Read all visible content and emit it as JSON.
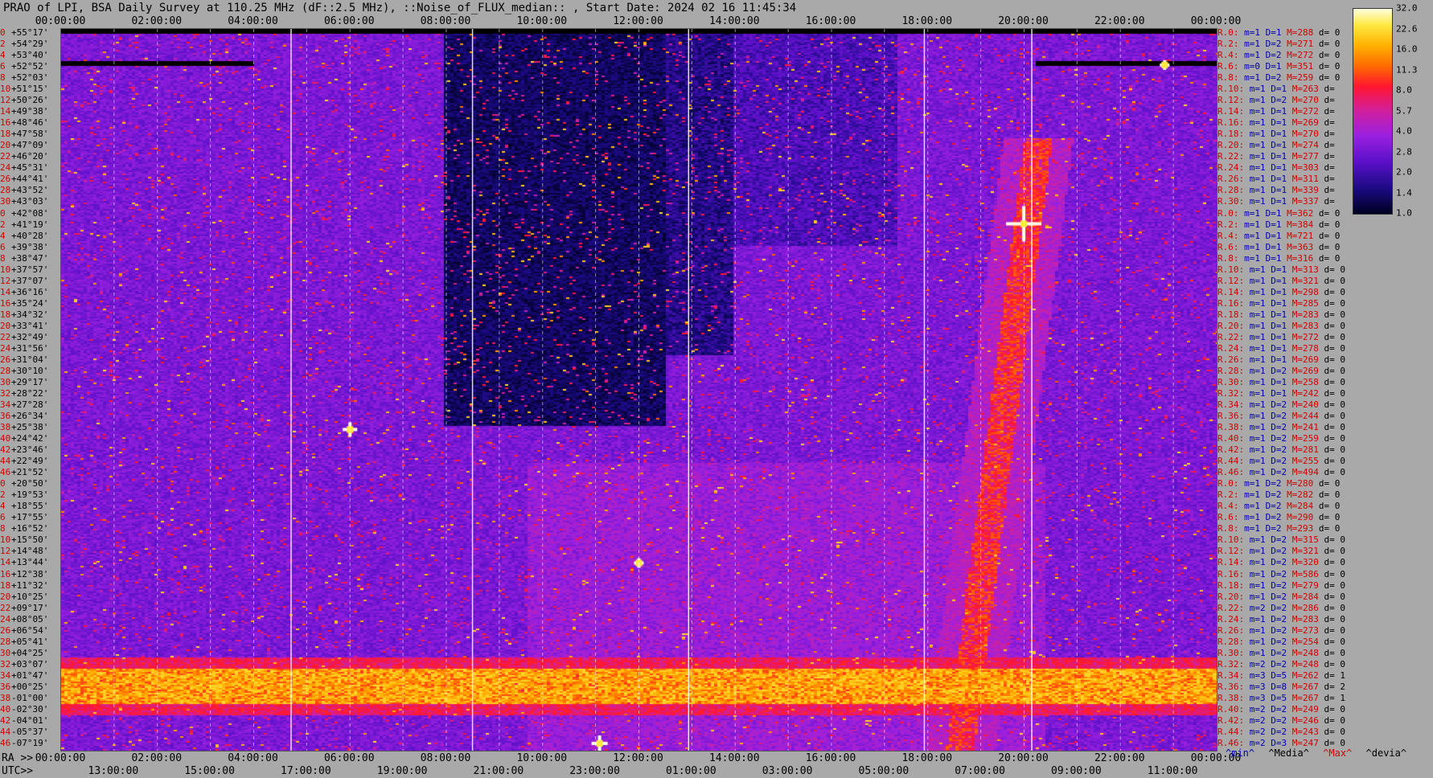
{
  "header": {
    "title": "PRAO of LPI, BSA Daily Survey at 110.25 MHz (dF::2.5 MHz), ::Noise_of_FLUX_median:: , Start Date: 2024 02 16 11:45:34"
  },
  "top_axis": {
    "ticks": [
      "00:00:00",
      "02:00:00",
      "04:00:00",
      "06:00:00",
      "08:00:00",
      "10:00:00",
      "12:00:00",
      "14:00:00",
      "16:00:00",
      "18:00:00",
      "20:00:00",
      "22:00:00",
      "00:00:00"
    ]
  },
  "bottom_axis": {
    "ra_prefix": "RA >>",
    "ra_ticks": [
      "00:00:00",
      "02:00:00",
      "04:00:00",
      "06:00:00",
      "08:00:00",
      "10:00:00",
      "12:00:00",
      "14:00:00",
      "16:00:00",
      "18:00:00",
      "20:00:00",
      "22:00:00",
      "00:00:00"
    ],
    "utc_prefix": "UTC>>",
    "utc_ticks": [
      "13:00:00",
      "15:00:00",
      "17:00:00",
      "19:00:00",
      "21:00:00",
      "23:00:00",
      "01:00:00",
      "03:00:00",
      "05:00:00",
      "07:00:00",
      "09:00:00",
      "11:00:00"
    ]
  },
  "left_labels": {
    "rows": [
      {
        "idx": "0",
        "dec": "+55°17'"
      },
      {
        "idx": "2",
        "dec": "+54°29'"
      },
      {
        "idx": "4",
        "dec": "+53°40'"
      },
      {
        "idx": "6",
        "dec": "+52°52'"
      },
      {
        "idx": "8",
        "dec": "+52°03'"
      },
      {
        "idx": "10",
        "dec": "+51°15'"
      },
      {
        "idx": "12",
        "dec": "+50°26'"
      },
      {
        "idx": "14",
        "dec": "+49°38'"
      },
      {
        "idx": "16",
        "dec": "+48°46'"
      },
      {
        "idx": "18",
        "dec": "+47°58'"
      },
      {
        "idx": "20",
        "dec": "+47°09'"
      },
      {
        "idx": "22",
        "dec": "+46°20'"
      },
      {
        "idx": "24",
        "dec": "+45°31'"
      },
      {
        "idx": "26",
        "dec": "+44°41'"
      },
      {
        "idx": "28",
        "dec": "+43°52'"
      },
      {
        "idx": "30",
        "dec": "+43°03'"
      },
      {
        "idx": "0",
        "dec": "+42°08'"
      },
      {
        "idx": "2",
        "dec": "+41°19'"
      },
      {
        "idx": "4",
        "dec": "+40°28'"
      },
      {
        "idx": "6",
        "dec": "+39°38'"
      },
      {
        "idx": "8",
        "dec": "+38°47'"
      },
      {
        "idx": "10",
        "dec": "+37°57'"
      },
      {
        "idx": "12",
        "dec": "+37°07'"
      },
      {
        "idx": "14",
        "dec": "+36°16'"
      },
      {
        "idx": "16",
        "dec": "+35°24'"
      },
      {
        "idx": "18",
        "dec": "+34°32'"
      },
      {
        "idx": "20",
        "dec": "+33°41'"
      },
      {
        "idx": "22",
        "dec": "+32°49'"
      },
      {
        "idx": "24",
        "dec": "+31°56'"
      },
      {
        "idx": "26",
        "dec": "+31°04'"
      },
      {
        "idx": "28",
        "dec": "+30°10'"
      },
      {
        "idx": "30",
        "dec": "+29°17'"
      },
      {
        "idx": "32",
        "dec": "+28°22'"
      },
      {
        "idx": "34",
        "dec": "+27°28'"
      },
      {
        "idx": "36",
        "dec": "+26°34'"
      },
      {
        "idx": "38",
        "dec": "+25°38'"
      },
      {
        "idx": "40",
        "dec": "+24°42'"
      },
      {
        "idx": "42",
        "dec": "+23°46'"
      },
      {
        "idx": "44",
        "dec": "+22°49'"
      },
      {
        "idx": "46",
        "dec": "+21°52'"
      },
      {
        "idx": "0",
        "dec": "+20°50'"
      },
      {
        "idx": "2",
        "dec": "+19°53'"
      },
      {
        "idx": "4",
        "dec": "+18°55'"
      },
      {
        "idx": "6",
        "dec": "+17°55'"
      },
      {
        "idx": "8",
        "dec": "+16°52'"
      },
      {
        "idx": "10",
        "dec": "+15°50'"
      },
      {
        "idx": "12",
        "dec": "+14°48'"
      },
      {
        "idx": "14",
        "dec": "+13°44'"
      },
      {
        "idx": "16",
        "dec": "+12°38'"
      },
      {
        "idx": "18",
        "dec": "+11°32'"
      },
      {
        "idx": "20",
        "dec": "+10°25'"
      },
      {
        "idx": "22",
        "dec": "+09°17'"
      },
      {
        "idx": "24",
        "dec": "+08°05'"
      },
      {
        "idx": "26",
        "dec": "+06°54'"
      },
      {
        "idx": "28",
        "dec": "+05°41'"
      },
      {
        "idx": "30",
        "dec": "+04°25'"
      },
      {
        "idx": "32",
        "dec": "+03°07'"
      },
      {
        "idx": "34",
        "dec": "+01°47'"
      },
      {
        "idx": "36",
        "dec": "+00°25'"
      },
      {
        "idx": "38",
        "dec": "-01°00'"
      },
      {
        "idx": "40",
        "dec": "-02°30'"
      },
      {
        "idx": "42",
        "dec": "-04°01'"
      },
      {
        "idx": "44",
        "dec": "-05°37'"
      },
      {
        "idx": "46",
        "dec": "-07°19'"
      }
    ]
  },
  "right_stats": {
    "rows": [
      {
        "r": "R.0:",
        "m": "m=1",
        "D": "D=1",
        "M": "M=288",
        "d": "d= 0"
      },
      {
        "r": "R.2:",
        "m": "m=1",
        "D": "D=2",
        "M": "M=271",
        "d": "d= 0"
      },
      {
        "r": "R.4:",
        "m": "m=1",
        "D": "D=2",
        "M": "M=272",
        "d": "d= 0"
      },
      {
        "r": "R.6:",
        "m": "m=0",
        "D": "D=1",
        "M": "M=351",
        "d": "d= 0"
      },
      {
        "r": "R.8:",
        "m": "m=1",
        "D": "D=2",
        "M": "M=259",
        "d": "d= 0"
      },
      {
        "r": "R.10:",
        "m": "m=1",
        "D": "D=1",
        "M": "M=263",
        "d": "d="
      },
      {
        "r": "R.12:",
        "m": "m=1",
        "D": "D=2",
        "M": "M=270",
        "d": "d="
      },
      {
        "r": "R.14:",
        "m": "m=1",
        "D": "D=1",
        "M": "M=272",
        "d": "d="
      },
      {
        "r": "R.16:",
        "m": "m=1",
        "D": "D=1",
        "M": "M=269",
        "d": "d="
      },
      {
        "r": "R.18:",
        "m": "m=1",
        "D": "D=1",
        "M": "M=270",
        "d": "d="
      },
      {
        "r": "R.20:",
        "m": "m=1",
        "D": "D=1",
        "M": "M=274",
        "d": "d="
      },
      {
        "r": "R.22:",
        "m": "m=1",
        "D": "D=1",
        "M": "M=277",
        "d": "d="
      },
      {
        "r": "R.24:",
        "m": "m=1",
        "D": "D=1",
        "M": "M=303",
        "d": "d="
      },
      {
        "r": "R.26:",
        "m": "m=1",
        "D": "D=1",
        "M": "M=311",
        "d": "d="
      },
      {
        "r": "R.28:",
        "m": "m=1",
        "D": "D=1",
        "M": "M=339",
        "d": "d="
      },
      {
        "r": "R.30:",
        "m": "m=1",
        "D": "D=1",
        "M": "M=337",
        "d": "d="
      },
      {
        "r": "R.0:",
        "m": "m=1",
        "D": "D=1",
        "M": "M=362",
        "d": "d= 0"
      },
      {
        "r": "R.2:",
        "m": "m=1",
        "D": "D=1",
        "M": "M=384",
        "d": "d= 0"
      },
      {
        "r": "R.4:",
        "m": "m=1",
        "D": "D=1",
        "M": "M=721",
        "d": "d= 0"
      },
      {
        "r": "R.6:",
        "m": "m=1",
        "D": "D=1",
        "M": "M=363",
        "d": "d= 0"
      },
      {
        "r": "R.8:",
        "m": "m=1",
        "D": "D=1",
        "M": "M=316",
        "d": "d= 0"
      },
      {
        "r": "R.10:",
        "m": "m=1",
        "D": "D=1",
        "M": "M=313",
        "d": "d= 0"
      },
      {
        "r": "R.12:",
        "m": "m=1",
        "D": "D=1",
        "M": "M=321",
        "d": "d= 0"
      },
      {
        "r": "R.14:",
        "m": "m=1",
        "D": "D=1",
        "M": "M=298",
        "d": "d= 0"
      },
      {
        "r": "R.16:",
        "m": "m=1",
        "D": "D=1",
        "M": "M=285",
        "d": "d= 0"
      },
      {
        "r": "R.18:",
        "m": "m=1",
        "D": "D=1",
        "M": "M=283",
        "d": "d= 0"
      },
      {
        "r": "R.20:",
        "m": "m=1",
        "D": "D=1",
        "M": "M=283",
        "d": "d= 0"
      },
      {
        "r": "R.22:",
        "m": "m=1",
        "D": "D=1",
        "M": "M=272",
        "d": "d= 0"
      },
      {
        "r": "R.24:",
        "m": "m=1",
        "D": "D=1",
        "M": "M=278",
        "d": "d= 0"
      },
      {
        "r": "R.26:",
        "m": "m=1",
        "D": "D=1",
        "M": "M=269",
        "d": "d= 0"
      },
      {
        "r": "R.28:",
        "m": "m=1",
        "D": "D=2",
        "M": "M=269",
        "d": "d= 0"
      },
      {
        "r": "R.30:",
        "m": "m=1",
        "D": "D=1",
        "M": "M=258",
        "d": "d= 0"
      },
      {
        "r": "R.32:",
        "m": "m=1",
        "D": "D=1",
        "M": "M=242",
        "d": "d= 0"
      },
      {
        "r": "R.34:",
        "m": "m=1",
        "D": "D=2",
        "M": "M=240",
        "d": "d= 0"
      },
      {
        "r": "R.36:",
        "m": "m=1",
        "D": "D=2",
        "M": "M=244",
        "d": "d= 0"
      },
      {
        "r": "R.38:",
        "m": "m=1",
        "D": "D=2",
        "M": "M=241",
        "d": "d= 0"
      },
      {
        "r": "R.40:",
        "m": "m=1",
        "D": "D=2",
        "M": "M=259",
        "d": "d= 0"
      },
      {
        "r": "R.42:",
        "m": "m=1",
        "D": "D=2",
        "M": "M=281",
        "d": "d= 0"
      },
      {
        "r": "R.44:",
        "m": "m=1",
        "D": "D=2",
        "M": "M=255",
        "d": "d= 0"
      },
      {
        "r": "R.46:",
        "m": "m=1",
        "D": "D=2",
        "M": "M=494",
        "d": "d= 0"
      },
      {
        "r": "R.0:",
        "m": "m=1",
        "D": "D=2",
        "M": "M=280",
        "d": "d= 0"
      },
      {
        "r": "R.2:",
        "m": "m=1",
        "D": "D=2",
        "M": "M=282",
        "d": "d= 0"
      },
      {
        "r": "R.4:",
        "m": "m=1",
        "D": "D=2",
        "M": "M=284",
        "d": "d= 0"
      },
      {
        "r": "R.6:",
        "m": "m=1",
        "D": "D=2",
        "M": "M=290",
        "d": "d= 0"
      },
      {
        "r": "R.8:",
        "m": "m=1",
        "D": "D=2",
        "M": "M=293",
        "d": "d= 0"
      },
      {
        "r": "R.10:",
        "m": "m=1",
        "D": "D=2",
        "M": "M=315",
        "d": "d= 0"
      },
      {
        "r": "R.12:",
        "m": "m=1",
        "D": "D=2",
        "M": "M=321",
        "d": "d= 0"
      },
      {
        "r": "R.14:",
        "m": "m=1",
        "D": "D=2",
        "M": "M=320",
        "d": "d= 0"
      },
      {
        "r": "R.16:",
        "m": "m=1",
        "D": "D=2",
        "M": "M=586",
        "d": "d= 0"
      },
      {
        "r": "R.18:",
        "m": "m=1",
        "D": "D=2",
        "M": "M=279",
        "d": "d= 0"
      },
      {
        "r": "R.20:",
        "m": "m=1",
        "D": "D=2",
        "M": "M=284",
        "d": "d= 0"
      },
      {
        "r": "R.22:",
        "m": "m=2",
        "D": "D=2",
        "M": "M=286",
        "d": "d= 0"
      },
      {
        "r": "R.24:",
        "m": "m=1",
        "D": "D=2",
        "M": "M=283",
        "d": "d= 0"
      },
      {
        "r": "R.26:",
        "m": "m=1",
        "D": "D=2",
        "M": "M=273",
        "d": "d= 0"
      },
      {
        "r": "R.28:",
        "m": "m=1",
        "D": "D=2",
        "M": "M=254",
        "d": "d= 0"
      },
      {
        "r": "R.30:",
        "m": "m=1",
        "D": "D=2",
        "M": "M=248",
        "d": "d= 0"
      },
      {
        "r": "R.32:",
        "m": "m=2",
        "D": "D=2",
        "M": "M=248",
        "d": "d= 0"
      },
      {
        "r": "R.34:",
        "m": "m=3",
        "D": "D=5",
        "M": "M=262",
        "d": "d= 1"
      },
      {
        "r": "R.36:",
        "m": "m=3",
        "D": "D=8",
        "M": "M=267",
        "d": "d= 2"
      },
      {
        "r": "R.38:",
        "m": "m=3",
        "D": "D=5",
        "M": "M=267",
        "d": "d= 1"
      },
      {
        "r": "R.40:",
        "m": "m=2",
        "D": "D=2",
        "M": "M=249",
        "d": "d= 0"
      },
      {
        "r": "R.42:",
        "m": "m=2",
        "D": "D=2",
        "M": "M=246",
        "d": "d= 0"
      },
      {
        "r": "R.44:",
        "m": "m=2",
        "D": "D=2",
        "M": "M=243",
        "d": "d= 0"
      },
      {
        "r": "R.46:",
        "m": "m=2",
        "D": "D=3",
        "M": "M=247",
        "d": "d= 0"
      }
    ]
  },
  "colorbar": {
    "ticks": [
      "32.0",
      "22.6",
      "16.0",
      "11.3",
      "8.0",
      "5.7",
      "4.0",
      "2.8",
      "2.0",
      "1.4",
      "1.0"
    ],
    "colors": [
      "#000022",
      "#1a0a80",
      "#5a10c8",
      "#9a20e0",
      "#d020a0",
      "#ff1530",
      "#ff6a00",
      "#ffb000",
      "#ffe840",
      "#ffffe0"
    ]
  },
  "legend": {
    "min": "^min^",
    "median": "^Media^",
    "max": "^Max^",
    "dev": "^devia^"
  },
  "chart_data": {
    "type": "heatmap",
    "title": "PRAO of LPI, BSA Daily Survey at 110.25 MHz (dF::2.5 MHz), ::Noise_of_FLUX_median:: , Start Date: 2024 02 16 11:45:34",
    "x_axis": {
      "range": [
        "00:00:00",
        "24:00:00"
      ],
      "label": "RA"
    },
    "y_axis": {
      "range": [
        "+55°17'",
        "-07°19'"
      ]
    },
    "value_range": [
      1.0,
      32.0
    ],
    "scale": "log2",
    "rows": 64,
    "features": [
      {
        "desc": "bright saturated horizontal band",
        "dec_from": "+01°47'",
        "dec_to": "-01°00'",
        "ra_from": "00:00:00",
        "ra_to": "24:00:00",
        "level": 16.0
      },
      {
        "desc": "dark low-noise region",
        "dec_from": "+52°03'",
        "dec_to": "+24°42'",
        "ra_from": "08:00:00",
        "ra_to": "12:00:00",
        "level": 1.2
      },
      {
        "desc": "diagonal bright streak",
        "ra_start": "18:30:00",
        "ra_end": "20:30:00",
        "dec_start": "-07°19'",
        "dec_end": "+45°31'",
        "level": 8.0
      },
      {
        "desc": "bright point source",
        "ra": "20:00:00",
        "dec": "+41°19'",
        "level": 32.0
      },
      {
        "desc": "bright point source",
        "ra": "06:00:00",
        "dec": "+22°49'",
        "level": 22.6
      },
      {
        "desc": "bright point source",
        "ra": "12:30:00",
        "dec": "-07°19'",
        "level": 32.0
      },
      {
        "desc": "black masked rows",
        "dec": "+52°52'",
        "ra_from": "00:00:00",
        "ra_to": "04:00:00",
        "level": 0
      },
      {
        "desc": "black masked rows",
        "dec": "+52°52'",
        "ra_from": "20:30:00",
        "ra_to": "24:00:00",
        "level": 0
      }
    ]
  }
}
